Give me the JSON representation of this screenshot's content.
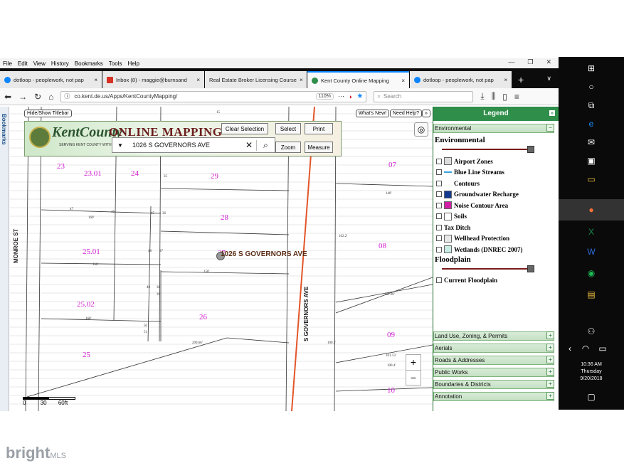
{
  "menu": [
    "File",
    "Edit",
    "View",
    "History",
    "Bookmarks",
    "Tools",
    "Help"
  ],
  "window_controls": [
    "—",
    "❐",
    "✕"
  ],
  "tabs": [
    {
      "title": "dotloop - peoplework, not pap",
      "color": "#0a84ff"
    },
    {
      "title": "Inbox (8) - maggie@burnsand",
      "color": "#d93025"
    },
    {
      "title": "Real Estate Broker Licensing Course",
      "color": "#5f6368"
    },
    {
      "title": "Kent County Online Mapping",
      "color": "#2f8e4a"
    },
    {
      "title": "dotloop - peoplework, not pap",
      "color": "#0a84ff"
    }
  ],
  "tab_close_glyph": "×",
  "new_tab_glyph": "+",
  "tab_overflow_glyph": "∨",
  "url": "co.kent.de.us/Apps/KentCountyMapping/",
  "zoom_level": "110%",
  "search_placeholder": "Search",
  "bookmarks_label": "Bookmarks",
  "map": {
    "hide_titlebar": "Hide/Show Titlebar",
    "whats_new": "What's New!",
    "need_help": "Need Help?",
    "logo_text": "KentCounty",
    "logo_subtitle": "SERVING KENT COUNTY WITH PRIDE",
    "banner_title": "ONLINE MAPPING",
    "buttons": {
      "clear_selection": "Clear Selection",
      "select": "Select",
      "print": "Print",
      "zoom": "Zoom",
      "measure": "Measure"
    },
    "address_value": "1026 S GOVERNORS AVE",
    "address_marker_label": "1026 S GOVERNORS AVE",
    "streets": {
      "monroe": "MONROE ST",
      "governors": "S GOVERNORS AVE"
    },
    "lots": [
      "23",
      "23.01",
      "24",
      "29",
      "07",
      "28",
      "25.01",
      "27",
      "08",
      "25.02",
      "26",
      "09",
      "25",
      "10"
    ],
    "dims": [
      "35",
      "15",
      "47",
      "46",
      "45",
      "36",
      "160'",
      "48",
      "37",
      "160'",
      "150'",
      "49",
      "38",
      "39",
      "160'",
      "50",
      "51",
      "209.66'",
      "140'",
      "181.26'",
      "100.5'",
      "161.13'",
      "100.4'",
      "162.2'"
    ],
    "scale": {
      "labels": [
        "0",
        "30",
        "60ft"
      ]
    },
    "zoom_in": "+",
    "zoom_out": "−"
  },
  "legend": {
    "title": "Legend",
    "top_section": "Environmental",
    "environmental_title": "Environmental",
    "items": [
      {
        "label": "Airport Zones",
        "swatch": "#dcdcdc",
        "kind": "box"
      },
      {
        "label": "Blue Line Streams",
        "swatch": "#3aa0e0",
        "kind": "line"
      },
      {
        "label": "Contours",
        "swatch": "#ffffff",
        "kind": "none"
      },
      {
        "label": "Groundwater Recharge",
        "swatch": "#123a8f",
        "kind": "box"
      },
      {
        "label": "Noise Contour Area",
        "swatch": "#d11fa6",
        "kind": "box"
      },
      {
        "label": "Soils",
        "swatch": "#ffffff",
        "kind": "box"
      },
      {
        "label": "Tax Ditch",
        "swatch": "",
        "kind": "none"
      },
      {
        "label": "Wellhead Protection",
        "swatch": "#e8e8e8",
        "kind": "box"
      },
      {
        "label": "Wetlands (DNREC 2007)",
        "swatch": "#c9ece4",
        "kind": "box"
      }
    ],
    "floodplain_title": "Floodplain",
    "floodplain_item": "Current Floodplain",
    "sections": [
      "Land Use, Zoning, & Permits",
      "Aerials",
      "Roads & Addresses",
      "Public Works",
      "Boundaries & Districts",
      "Annotation"
    ]
  },
  "taskbar": {
    "time": "10:36 AM",
    "day": "Thursday",
    "date": "9/20/2018"
  },
  "watermark": {
    "brand": "bright",
    "suffix": "MLS"
  }
}
